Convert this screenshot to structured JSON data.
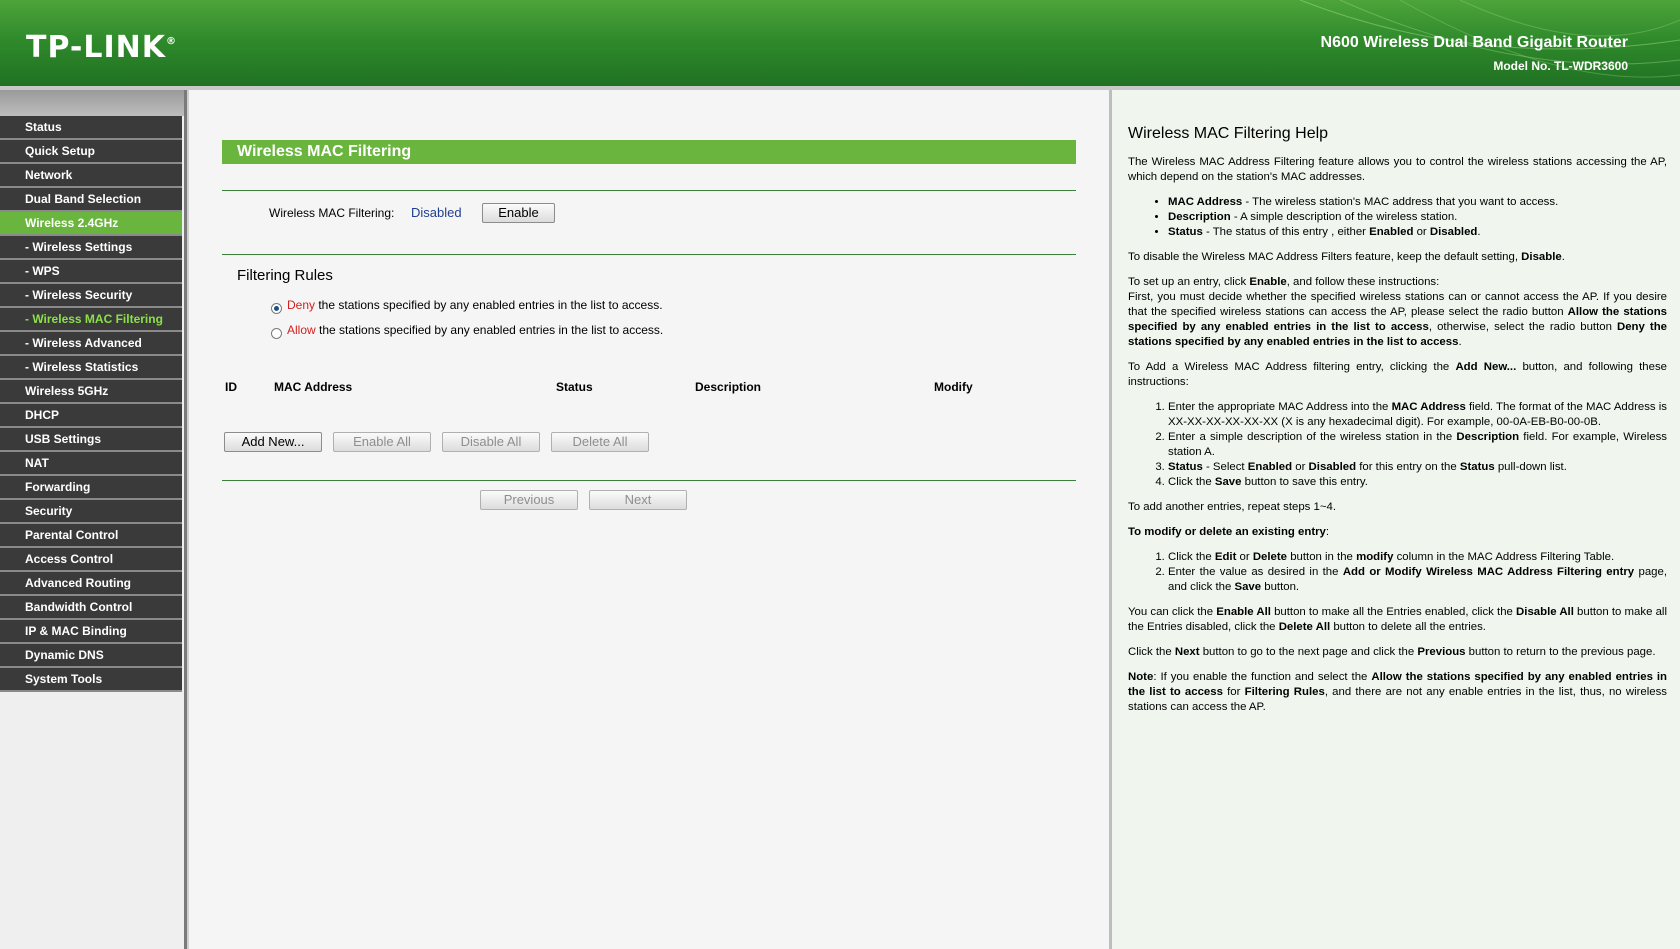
{
  "header": {
    "logo": "TP-LINK",
    "logo_mark": "®",
    "product": "N600 Wireless Dual Band Gigabit Router",
    "model": "Model No. TL-WDR3600"
  },
  "sidebar": {
    "items": [
      {
        "label": "Status"
      },
      {
        "label": "Quick Setup"
      },
      {
        "label": "Network"
      },
      {
        "label": "Dual Band Selection"
      },
      {
        "label": "Wireless 2.4GHz"
      },
      {
        "label": "- Wireless Settings"
      },
      {
        "label": "- WPS"
      },
      {
        "label": "- Wireless Security"
      },
      {
        "label": "- Wireless MAC Filtering"
      },
      {
        "label": "- Wireless Advanced"
      },
      {
        "label": "- Wireless Statistics"
      },
      {
        "label": "Wireless 5GHz"
      },
      {
        "label": "DHCP"
      },
      {
        "label": "USB Settings"
      },
      {
        "label": "NAT"
      },
      {
        "label": "Forwarding"
      },
      {
        "label": "Security"
      },
      {
        "label": "Parental Control"
      },
      {
        "label": "Access Control"
      },
      {
        "label": "Advanced Routing"
      },
      {
        "label": "Bandwidth Control"
      },
      {
        "label": "IP & MAC Binding"
      },
      {
        "label": "Dynamic DNS"
      },
      {
        "label": "System Tools"
      }
    ]
  },
  "main": {
    "title": "Wireless MAC Filtering",
    "filter_label": "Wireless MAC Filtering:",
    "filter_status": "Disabled",
    "enable_button": "Enable",
    "rules_title": "Filtering Rules",
    "deny_word": "Deny",
    "deny_text": " the stations specified by any enabled entries in the list to access.",
    "allow_word": "Allow",
    "allow_text": " the stations specified by any enabled entries in the list to access.",
    "table_headers": [
      "ID",
      "MAC Address",
      "Status",
      "Description",
      "Modify"
    ],
    "buttons": {
      "add_new": "Add New...",
      "enable_all": "Enable All",
      "disable_all": "Disable All",
      "delete_all": "Delete All",
      "previous": "Previous",
      "next": "Next"
    }
  },
  "help": {
    "title": "Wireless MAC Filtering Help"
  },
  "colors": {
    "accent_green": "#6ab53d",
    "header_green": "#2f8a2b",
    "nav_dark": "#3a3a3a",
    "status_blue": "#1f3f8f",
    "deny_red": "#d42020"
  }
}
